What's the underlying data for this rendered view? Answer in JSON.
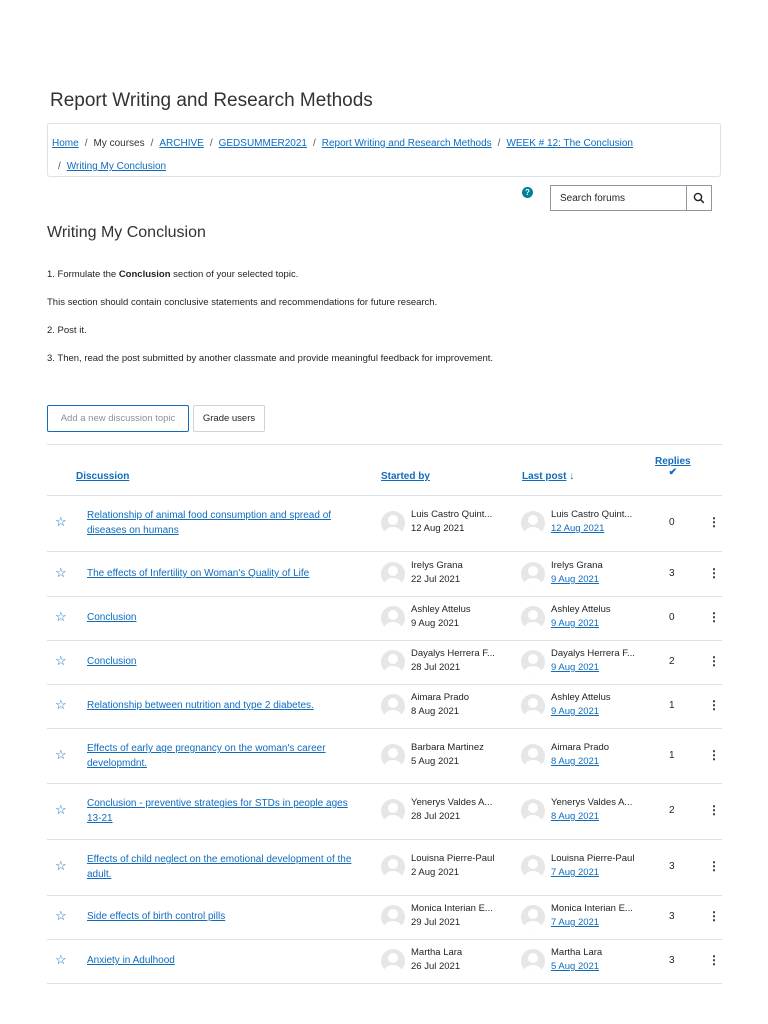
{
  "course_title": "Report Writing and Research Methods",
  "breadcrumb": {
    "home": "Home",
    "my_courses": "My courses",
    "archive": "ARCHIVE",
    "category": "GEDSUMMER2021",
    "course": "Report Writing and Research Methods",
    "section": "WEEK # 12: The Conclusion",
    "current": "Writing My Conclusion",
    "separator": "/"
  },
  "search": {
    "placeholder": "Search forums",
    "icon": "search-icon"
  },
  "help_icon": "question-circle-icon",
  "page_title": "Writing My Conclusion",
  "intro": {
    "line1_prefix": "1. Formulate the ",
    "line1_bold": "Conclusion",
    "line1_suffix": " section of your selected topic.",
    "line2": "This section should contain conclusive statements and recommendations for future research.",
    "line3": "2. Post it.",
    "line4": "3. Then, read the post submitted by another classmate and provide meaningful feedback for improvement."
  },
  "buttons": {
    "add_topic": "Add a new discussion topic",
    "grade_users": "Grade users"
  },
  "table": {
    "headers": {
      "discussion": "Discussion",
      "started_by": "Started by",
      "last_post": "Last post",
      "last_post_sort": "↓",
      "replies": "Replies",
      "replies_check": "✔"
    },
    "rows": [
      {
        "title": "Relationship of animal food consumption and spread of diseases on humans",
        "started_by": "Luis Castro Quint...",
        "started_date": "12 Aug 2021",
        "last_by": "Luis Castro Quint...",
        "last_date": "12 Aug 2021",
        "replies": "0"
      },
      {
        "title": "The effects of Infertility on Woman's Quality of Life",
        "started_by": "Irelys Grana",
        "started_date": "22 Jul 2021",
        "last_by": "Irelys Grana",
        "last_date": "9 Aug 2021",
        "replies": "3"
      },
      {
        "title": "Conclusion",
        "started_by": "Ashley Attelus",
        "started_date": "9 Aug 2021",
        "last_by": "Ashley Attelus",
        "last_date": "9 Aug 2021",
        "replies": "0"
      },
      {
        "title": "Conclusion",
        "started_by": "Dayalys Herrera F...",
        "started_date": "28 Jul 2021",
        "last_by": "Dayalys Herrera F...",
        "last_date": "9 Aug 2021",
        "replies": "2"
      },
      {
        "title": "Relationship between nutrition and type 2 diabetes.",
        "started_by": "Aimara Prado",
        "started_date": "8 Aug 2021",
        "last_by": "Ashley Attelus",
        "last_date": "9 Aug 2021",
        "replies": "1"
      },
      {
        "title": "Effects of early age pregnancy on the woman's career developmdnt.",
        "started_by": "Barbara Martinez",
        "started_date": "5 Aug 2021",
        "last_by": "Aimara Prado",
        "last_date": "8 Aug 2021",
        "replies": "1"
      },
      {
        "title": "Conclusion - preventive strategies for STDs in people ages 13-21",
        "started_by": "Yenerys Valdes A...",
        "started_date": "28 Jul 2021",
        "last_by": "Yenerys Valdes A...",
        "last_date": "8 Aug 2021",
        "replies": "2"
      },
      {
        "title": "Effects of child neglect on the emotional development of the adult.",
        "started_by": "Louisna Pierre-Paul",
        "started_date": "2 Aug 2021",
        "last_by": "Louisna Pierre-Paul",
        "last_date": "7 Aug 2021",
        "replies": "3"
      },
      {
        "title": "Side effects of birth control pills",
        "started_by": "Monica Interian E...",
        "started_date": "29 Jul 2021",
        "last_by": "Monica Interian E...",
        "last_date": "7 Aug 2021",
        "replies": "3"
      },
      {
        "title": "Anxiety in Adulhood",
        "started_by": "Martha Lara",
        "started_date": "26 Jul 2021",
        "last_by": "Martha Lara",
        "last_date": "5 Aug 2021",
        "replies": "3"
      }
    ]
  },
  "colors": {
    "link": "#0f6cbf",
    "border": "#dee2e6",
    "help": "#008196"
  }
}
